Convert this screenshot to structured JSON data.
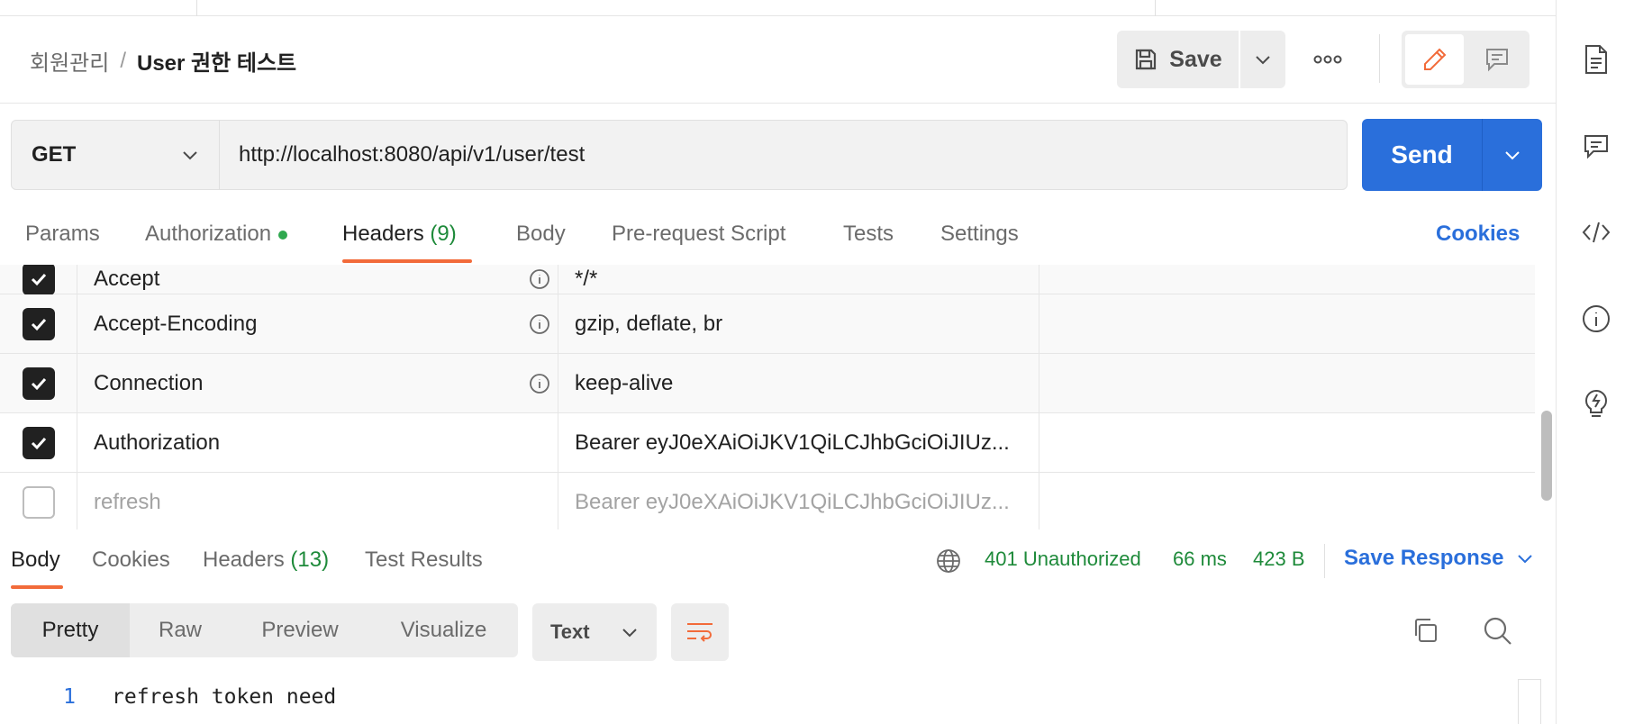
{
  "breadcrumb": {
    "parent": "회원관리",
    "separator": "/",
    "current": "User 권한 테스트"
  },
  "toolbar": {
    "save_label": "Save"
  },
  "request": {
    "method": "GET",
    "url": "http://localhost:8080/api/v1/user/test",
    "send_label": "Send"
  },
  "request_tabs": [
    {
      "label": "Params"
    },
    {
      "label": "Authorization",
      "indicator": true
    },
    {
      "label": "Headers",
      "count": "(9)",
      "active": true
    },
    {
      "label": "Body"
    },
    {
      "label": "Pre-request Script"
    },
    {
      "label": "Tests"
    },
    {
      "label": "Settings"
    }
  ],
  "cookies_link": "Cookies",
  "headers": [
    {
      "key": "Accept",
      "value": "*/*",
      "checked": true,
      "info": true
    },
    {
      "key": "Accept-Encoding",
      "value": "gzip, deflate, br",
      "checked": true,
      "info": true
    },
    {
      "key": "Connection",
      "value": "keep-alive",
      "checked": true,
      "info": true
    },
    {
      "key": "Authorization",
      "value": "Bearer eyJ0eXAiOiJKV1QiLCJhbGciOiJIUz...",
      "checked": true,
      "info": false
    },
    {
      "key": "refresh",
      "value": "Bearer eyJ0eXAiOiJKV1QiLCJhbGciOiJIUz...",
      "checked": false,
      "info": false
    }
  ],
  "response_tabs": [
    {
      "label": "Body",
      "active": true
    },
    {
      "label": "Cookies"
    },
    {
      "label": "Headers",
      "count": "(13)"
    },
    {
      "label": "Test Results"
    }
  ],
  "response_status": {
    "code": "401 Unauthorized",
    "time": "66 ms",
    "size": "423 B"
  },
  "save_response_label": "Save Response",
  "view_modes": [
    "Pretty",
    "Raw",
    "Preview",
    "Visualize"
  ],
  "format_select": "Text",
  "response_body": [
    {
      "line": "1",
      "text": "refresh token need"
    }
  ],
  "colors": {
    "accent": "#2a6fdb",
    "tab_underline": "#f26b3a",
    "success": "#1e8a3a",
    "auth_dot": "#2fa84f"
  },
  "icons": {
    "right_sidebar": [
      "document-icon",
      "comment-icon",
      "code-icon",
      "info-icon",
      "lightbulb-icon"
    ],
    "header": [
      "save-icon",
      "chevron-down-icon",
      "more-icon",
      "edit-pencil-icon",
      "comment-icon"
    ],
    "response": [
      "globe-icon",
      "wrap-lines-icon",
      "copy-icon",
      "search-icon"
    ]
  }
}
